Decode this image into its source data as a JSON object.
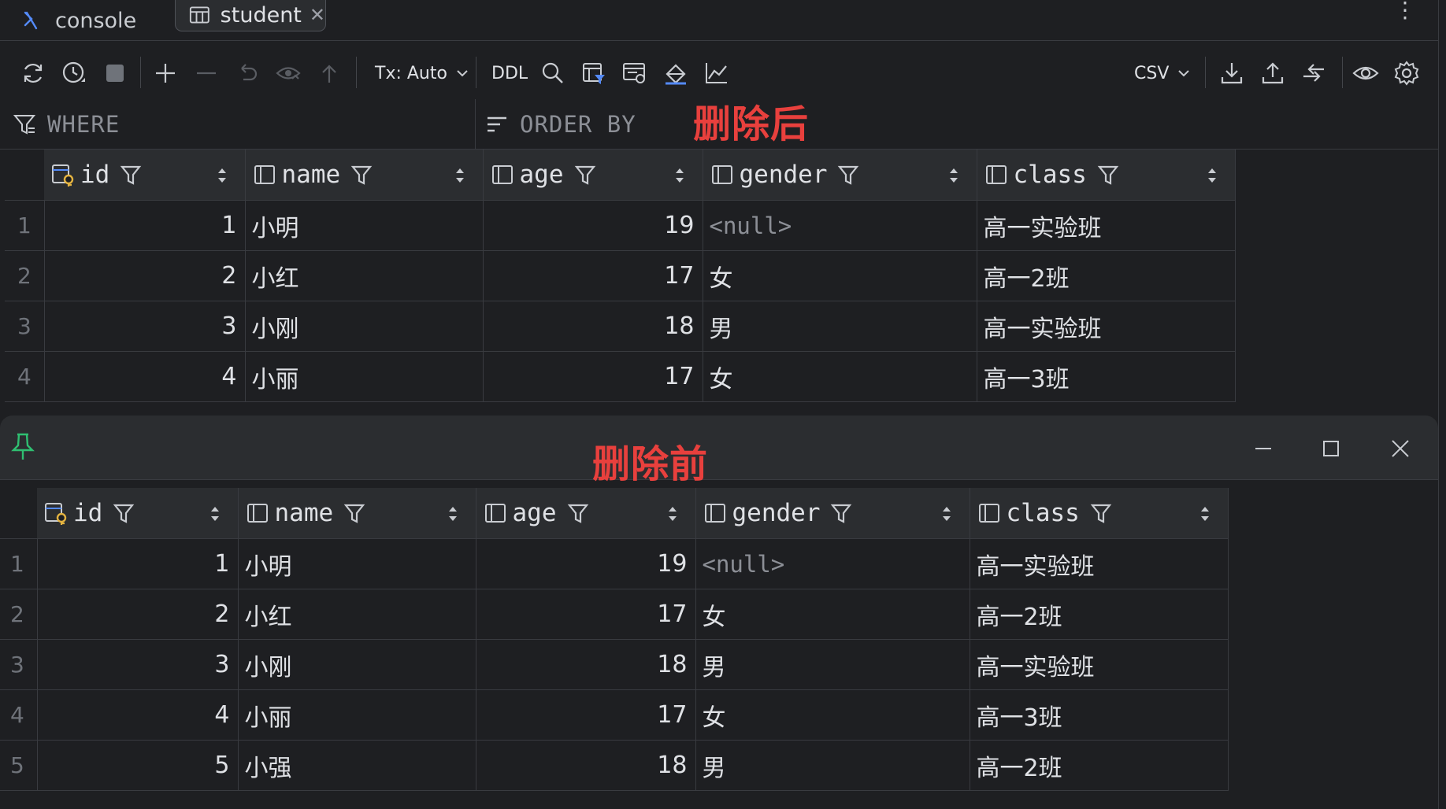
{
  "tabs": {
    "console": "console",
    "student": "student"
  },
  "toolbar": {
    "tx_mode": "Tx: Auto",
    "ddl": "DDL",
    "export_format": "CSV"
  },
  "filters": {
    "where": "WHERE",
    "order_by": "ORDER BY"
  },
  "annotations": {
    "after_delete": "删除后",
    "before_delete": "删除前"
  },
  "columns": [
    "id",
    "name",
    "age",
    "gender",
    "class"
  ],
  "after_rows": [
    {
      "n": "1",
      "id": "1",
      "name": "小明",
      "age": "19",
      "gender": "<null>",
      "class": "高一实验班"
    },
    {
      "n": "2",
      "id": "2",
      "name": "小红",
      "age": "17",
      "gender": "女",
      "class": "高一2班"
    },
    {
      "n": "3",
      "id": "3",
      "name": "小刚",
      "age": "18",
      "gender": "男",
      "class": "高一实验班"
    },
    {
      "n": "4",
      "id": "4",
      "name": "小丽",
      "age": "17",
      "gender": "女",
      "class": "高一3班"
    }
  ],
  "before_rows": [
    {
      "n": "1",
      "id": "1",
      "name": "小明",
      "age": "19",
      "gender": "<null>",
      "class": "高一实验班"
    },
    {
      "n": "2",
      "id": "2",
      "name": "小红",
      "age": "17",
      "gender": "女",
      "class": "高一2班"
    },
    {
      "n": "3",
      "id": "3",
      "name": "小刚",
      "age": "18",
      "gender": "男",
      "class": "高一实验班"
    },
    {
      "n": "4",
      "id": "4",
      "name": "小丽",
      "age": "17",
      "gender": "女",
      "class": "高一3班"
    },
    {
      "n": "5",
      "id": "5",
      "name": "小强",
      "age": "18",
      "gender": "男",
      "class": "高一2班"
    }
  ],
  "icons": {
    "console": "console-icon",
    "table": "table-icon",
    "primary_key": "primary-key-icon",
    "column": "column-icon",
    "filter": "filter-icon",
    "sort": "sort-icon",
    "pin": "pin-icon"
  },
  "colors": {
    "background": "#1e1f22",
    "header": "#2b2d30",
    "annotation": "#e8403d",
    "pin": "#2fbf71",
    "key": "#e3b341",
    "key_accent": "#548af7"
  }
}
